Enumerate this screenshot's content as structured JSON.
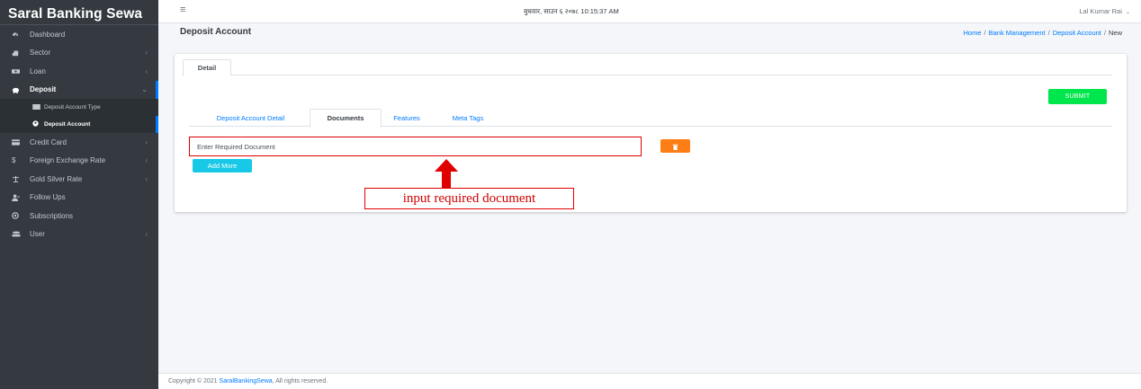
{
  "brand": "Saral Banking Sewa",
  "sidebar": {
    "items": [
      {
        "label": "Dashboard",
        "icon": "tachometer-icon"
      },
      {
        "label": "Sector",
        "icon": "layer-icon"
      },
      {
        "label": "Loan",
        "icon": "money-icon"
      },
      {
        "label": "Deposit",
        "icon": "piggy-bank-icon"
      },
      {
        "label": "Credit Card",
        "icon": "credit-card-icon"
      },
      {
        "label": "Foreign Exchange Rate",
        "icon": "dollar-icon"
      },
      {
        "label": "Gold Silver Rate",
        "icon": "balance-scale-icon"
      },
      {
        "label": "Follow Ups",
        "icon": "user-plus-icon"
      },
      {
        "label": "Subscriptions",
        "icon": "globe-icon"
      },
      {
        "label": "User",
        "icon": "users-icon"
      }
    ],
    "deposit_subitems": [
      {
        "label": "Deposit Account Type",
        "icon": "list-icon"
      },
      {
        "label": "Deposit Account",
        "icon": "circle-icon"
      }
    ]
  },
  "header": {
    "datetime": "बुधवार, साउन ६ २०७८ 10:15:37 AM",
    "user": "Lal Kumar Rai"
  },
  "content_header": {
    "title": "Deposit Account",
    "breadcrumb": [
      "Home",
      "Bank Management",
      "Deposit Account",
      "New"
    ]
  },
  "card": {
    "outer_tab": "Detail",
    "submit_label": "SUBMIT",
    "inner_tabs": [
      "Deposit Account Detail",
      "Documents",
      "Features",
      "Meta Tags"
    ],
    "document_input_placeholder": "Enter Required Document",
    "add_more_label": "Add More"
  },
  "annotation": {
    "text": "input required document",
    "color": "#e10000"
  },
  "footer": {
    "prefix": "Copyright © 2021",
    "link": "SaralBankingSewa",
    "suffix": ", All rights reserved."
  },
  "colors": {
    "sidebar_bg": "#343a40",
    "accent": "#007bff",
    "submit": "#00e64d",
    "delete": "#fd7e14",
    "add_more": "#17c9e6"
  }
}
